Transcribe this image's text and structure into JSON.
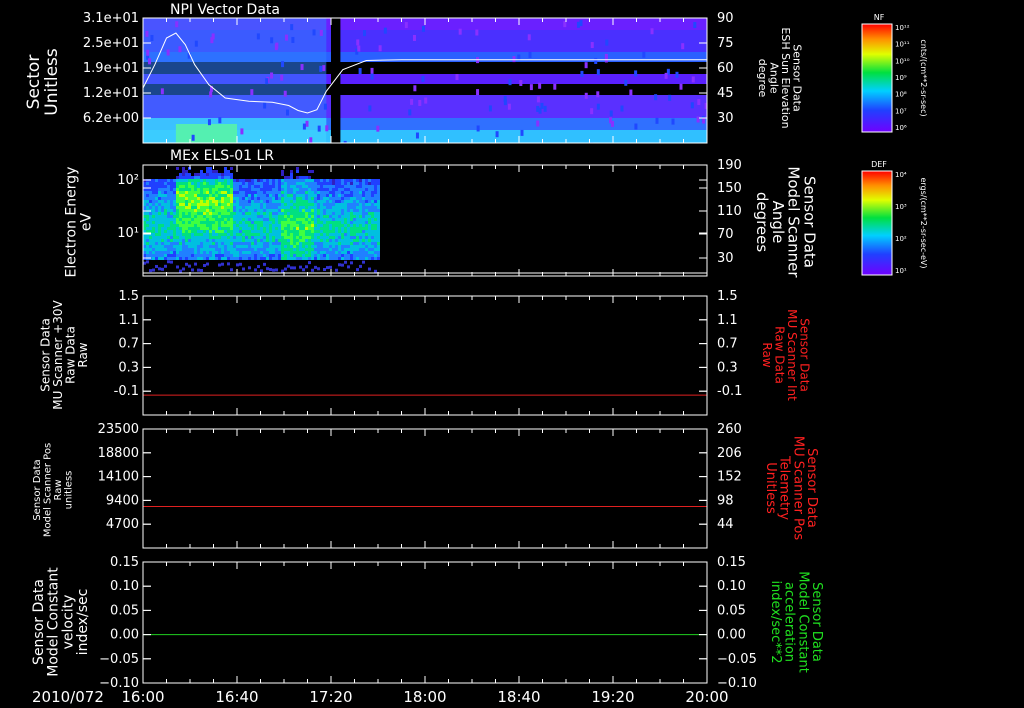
{
  "chart_data": [
    {
      "type": "heatmap",
      "title": "NPI Vector Data",
      "ylabel": [
        "Sector",
        "Unitless"
      ],
      "yticks": [
        "3.1e+01",
        "2.5e+01",
        "1.9e+01",
        "1.2e+01",
        "6.2e+00"
      ],
      "y2label": [
        "Sensor Data",
        "ESH Sun Elevation",
        "Angle",
        "degree"
      ],
      "y2ticks": [
        "90",
        "75",
        "60",
        "45",
        "30"
      ],
      "ylim2": [
        15,
        90
      ],
      "overlay_line": {
        "name": "ESH Sun Elevation Angle",
        "x_minutes": [
          0,
          5,
          10,
          14,
          18,
          22,
          28,
          35,
          45,
          55,
          62,
          66,
          70,
          74,
          78,
          85,
          95,
          110,
          130,
          170,
          240
        ],
        "y_degrees": [
          48,
          62,
          78,
          81,
          74,
          62,
          50,
          42,
          40,
          39.5,
          37.5,
          34.5,
          33,
          35,
          46,
          59,
          64.5,
          65,
          65,
          65,
          65
        ]
      },
      "colorbar": {
        "label": "NF",
        "units": "cnts/(cm**2-sr-sec)",
        "ticks": [
          "10¹²",
          "10¹¹",
          "10¹⁰",
          "10⁹",
          "10⁸",
          "10⁷",
          "10⁶"
        ]
      },
      "data_gap_minutes": [
        80,
        84
      ]
    },
    {
      "type": "heatmap",
      "title": "MEx ELS-01 LR",
      "ylabel": [
        "Electron Energy",
        "eV"
      ],
      "yticks": [
        "10²",
        "10¹"
      ],
      "y2label": [
        "Sensor Data",
        "Model Scanner",
        "Angle",
        "degrees"
      ],
      "y2ticks": [
        "190",
        "150",
        "110",
        "70",
        "30"
      ],
      "data_span_minutes": [
        0,
        100
      ],
      "colorbar": {
        "label": "DEF",
        "units": "ergs/(cm**2-sr-sec-eV)",
        "ticks": [
          "10⁴",
          "10³",
          "10²",
          "10¹"
        ]
      }
    },
    {
      "type": "line",
      "ylabel": [
        "Sensor Data",
        "MU Scanner +30V",
        "Raw Data",
        "Raw"
      ],
      "yticks": [
        "1.5",
        "1.1",
        "0.7",
        "0.3",
        "-0.1"
      ],
      "ylim": [
        -0.3,
        1.5
      ],
      "y2label": [
        "Sensor Data",
        "MU Scanner Int",
        "Raw Data",
        "Raw"
      ],
      "y2ticks": [
        "1.5",
        "1.1",
        "0.7",
        "0.3",
        "-0.1"
      ],
      "series": [
        {
          "values": [
            0,
            0
          ],
          "color": "#e02020"
        }
      ]
    },
    {
      "type": "line",
      "ylabel": [
        "Sensor Data",
        "Model Scanner Pos",
        "Raw",
        "unitless"
      ],
      "yticks": [
        "23500",
        "18800",
        "14100",
        "9400",
        "4700"
      ],
      "ylim": [
        0,
        23500
      ],
      "y2label": [
        "Sensor Data",
        "MU Scanner Pos",
        "Telemetry",
        "Unitless"
      ],
      "y2ticks": [
        "260",
        "206",
        "152",
        "98",
        "44"
      ],
      "series": [
        {
          "values": [
            8200,
            8200
          ],
          "color": "#e02020"
        }
      ]
    },
    {
      "type": "line",
      "ylabel": [
        "Sensor Data",
        "Model Constant",
        "velocity",
        "index/sec"
      ],
      "yticks": [
        "0.15",
        "0.10",
        "0.05",
        "0.00",
        "−0.05",
        "−0.10"
      ],
      "ylim": [
        -0.1,
        0.15
      ],
      "y2label": [
        "Sensor Data",
        "Model Constant",
        "acceleration",
        "index/sec**2"
      ],
      "y2ticks": [
        "0.15",
        "0.10",
        "0.05",
        "0.00",
        "−0.05",
        "−0.10"
      ],
      "series": [
        {
          "values": [
            0,
            0
          ],
          "color": "#20d020"
        }
      ]
    }
  ],
  "x_axis": {
    "date_label": "2010/072",
    "ticks": [
      "16:00",
      "16:40",
      "17:20",
      "18:00",
      "18:40",
      "19:20",
      "20:00"
    ],
    "range": [
      "16:00",
      "20:00"
    ]
  },
  "colors": {
    "red_label": "#ff2020",
    "green_label": "#20e020",
    "axis": "#ffffff"
  }
}
